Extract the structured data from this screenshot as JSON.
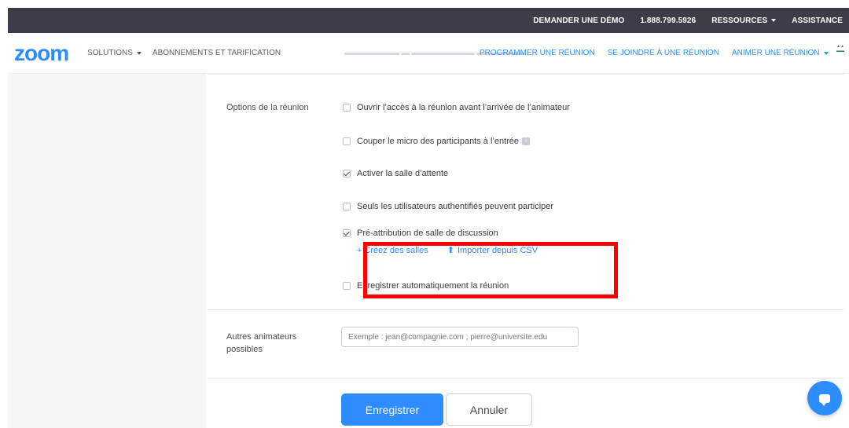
{
  "topbar": {
    "demo": "DEMANDER UNE DÉMO",
    "phone": "1.888.799.5926",
    "resources": "RESSOURCES",
    "support": "ASSISTANCE"
  },
  "nav": {
    "logo": "zoom",
    "solutions": "SOLUTIONS",
    "plans": "ABONNEMENTS ET TARIFICATION",
    "schedule": "PROGRAMMER UNE RÉUNION",
    "join": "SE JOINDRE À UNE RÉUNION",
    "host": "ANIMER UNE RÉUNION"
  },
  "options_label": "Options de la réunion",
  "options": [
    {
      "label": "Ouvrir l’accès à la réunion avant l’arrivée de l’animateur",
      "checked": false
    },
    {
      "label": "Couper le micro des participants à l’entrée",
      "checked": false
    },
    {
      "label": "Activer la salle d’attente",
      "checked": true
    },
    {
      "label": "Seuls les utilisateurs authentifiés peuvent participer",
      "checked": false
    },
    {
      "label": "Pré-attribution de salle de discussion",
      "checked": true
    },
    {
      "label": "Enregistrer automatiquement la réunion",
      "checked": false
    }
  ],
  "breakout": {
    "create": "Créez des salles",
    "import": "Importer depuis CSV"
  },
  "alt_hosts": {
    "label": "Autres animateurs possibles",
    "placeholder": "Exemple : jean@compagnie.com ; pierre@universite.edu"
  },
  "buttons": {
    "save": "Enregistrer",
    "cancel": "Annuler"
  },
  "colors": {
    "brand": "#2d8cff",
    "topbar": "#3d3d49",
    "highlight": "#ff0000"
  }
}
